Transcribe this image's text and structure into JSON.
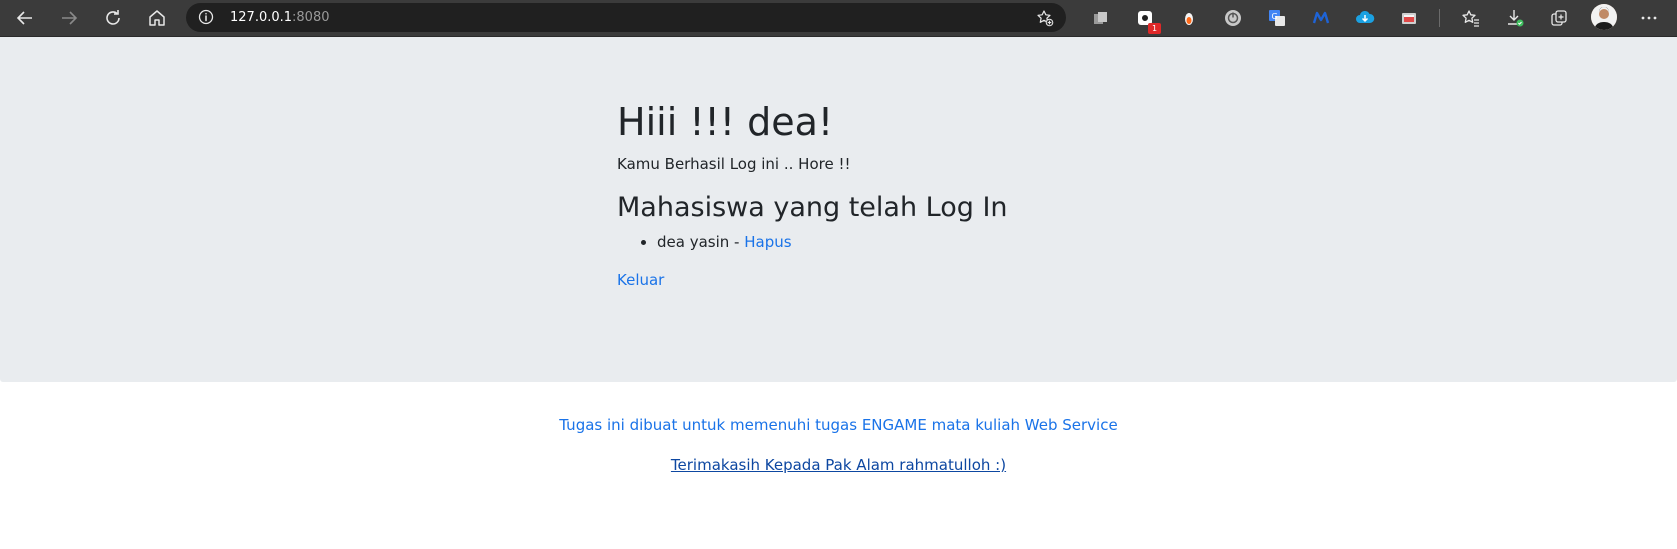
{
  "browser": {
    "url_host": "127.0.0.1",
    "url_port": ":8080",
    "extension_badge": "1",
    "icons": {
      "back": "back-arrow-icon",
      "forward": "forward-arrow-icon",
      "refresh": "refresh-icon",
      "home": "home-icon",
      "site_info": "info-icon",
      "add_favorite": "add-favorite-icon",
      "more": "more-menu-icon"
    }
  },
  "page": {
    "greeting": "Hiii !!! dea!",
    "lead": "Kamu Berhasil Log ini .. Hore !!",
    "subheading": "Mahasiswa yang telah Log In",
    "users": [
      {
        "name": "dea yasin",
        "separator": " - ",
        "action": "Hapus"
      }
    ],
    "logout": "Keluar"
  },
  "footer": {
    "note": "Tugas ini dibuat untuk memenuhi tugas ENGAME mata kuliah Web Service",
    "thanks": "Terimakasih Kepada Pak Alam rahmatulloh :)"
  },
  "colors": {
    "toolbar_bg": "#3b3b3b",
    "jumbotron_bg": "#e9ecef",
    "link": "#1a73e8"
  }
}
